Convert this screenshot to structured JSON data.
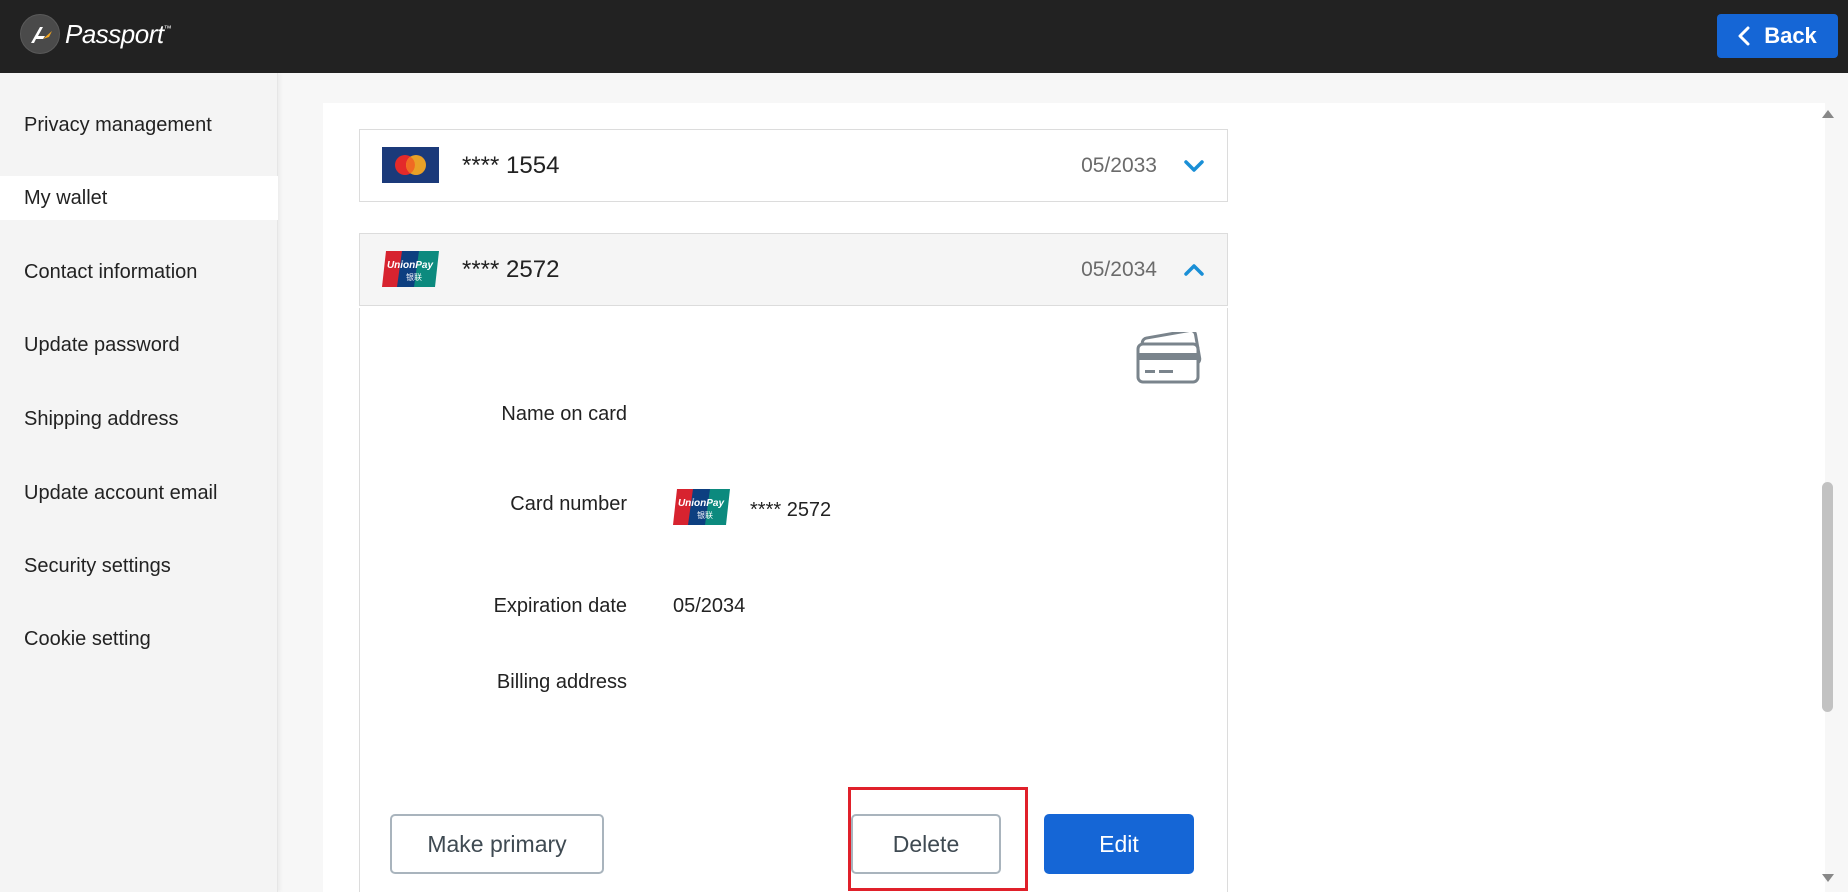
{
  "header": {
    "brand": "Passport",
    "brand_tm": "™",
    "back_label": "Back"
  },
  "sidebar": {
    "items": [
      {
        "label": "Privacy management"
      },
      {
        "label": "My wallet",
        "active": true
      },
      {
        "label": "Contact information"
      },
      {
        "label": "Update password"
      },
      {
        "label": "Shipping address"
      },
      {
        "label": "Update account email"
      },
      {
        "label": "Security settings"
      },
      {
        "label": "Cookie setting"
      }
    ]
  },
  "wallet": {
    "cards": [
      {
        "brand": "MasterCard",
        "masked_number": "**** 1554",
        "expiry": "05/2033",
        "expanded": false,
        "chevron_icon": "chevron-down-icon"
      },
      {
        "brand": "UnionPay",
        "masked_number": "**** 2572",
        "expiry": "05/2034",
        "expanded": true,
        "chevron_icon": "chevron-up-icon"
      }
    ],
    "details": {
      "name_label": "Name on card",
      "name_value": "",
      "number_label": "Card number",
      "number_value": "**** 2572",
      "number_brand": "UnionPay",
      "expiry_label": "Expiration date",
      "expiry_value": "05/2034",
      "billing_label": "Billing address",
      "billing_value": ""
    },
    "actions": {
      "make_primary": "Make primary",
      "delete": "Delete",
      "edit": "Edit"
    }
  },
  "colors": {
    "accent": "#1566d6",
    "chevron": "#1a8fd6",
    "highlight": "#e0202a",
    "topbar": "#222222"
  }
}
